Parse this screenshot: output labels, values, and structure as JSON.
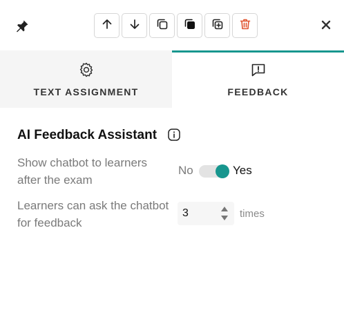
{
  "toolbar": {
    "buttons": [
      {
        "name": "move-up",
        "icon": "arrow-up-icon"
      },
      {
        "name": "move-down",
        "icon": "arrow-down-icon"
      },
      {
        "name": "copy",
        "icon": "copy-icon"
      },
      {
        "name": "paste",
        "icon": "paste-icon"
      },
      {
        "name": "duplicate",
        "icon": "duplicate-icon"
      },
      {
        "name": "delete",
        "icon": "trash-icon"
      }
    ],
    "close_label": "×"
  },
  "tabs": [
    {
      "label": "TEXT ASSIGNMENT",
      "icon": "gear-icon",
      "active": false
    },
    {
      "label": "FEEDBACK",
      "icon": "feedback-icon",
      "active": true
    }
  ],
  "section": {
    "title": "AI Feedback Assistant",
    "info_icon": "info-icon"
  },
  "show_chatbot": {
    "label": "Show chatbot to learners after the exam",
    "off_label": "No",
    "on_label": "Yes",
    "enabled": true
  },
  "ask_limit": {
    "label": "Learners can ask the chatbot for feedback",
    "value": "3",
    "unit": "times"
  },
  "colors": {
    "accent": "#17968e",
    "delete": "#e0532e",
    "inactive_tab_bg": "#f5f5f5"
  }
}
